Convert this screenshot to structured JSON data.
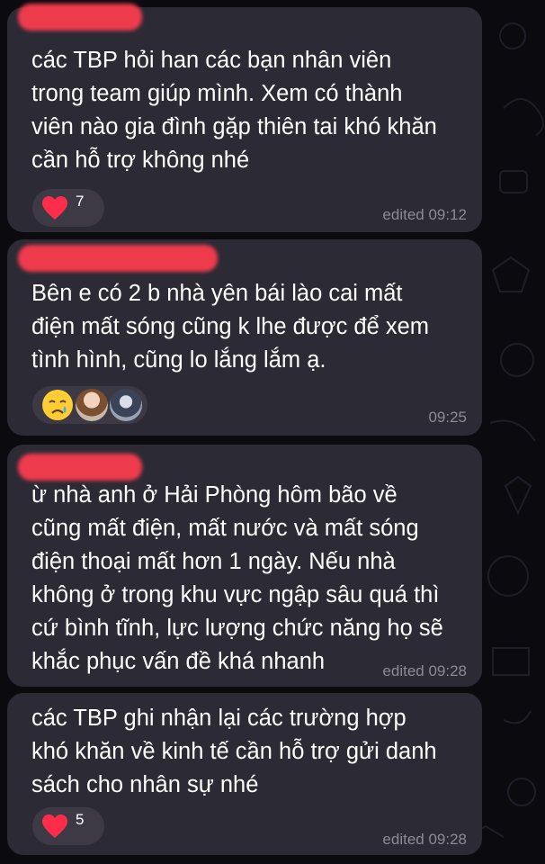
{
  "messages": [
    {
      "text": "các TBP hỏi han các bạn nhân viên\ntrong team giúp mình. Xem có thành\nviên nào gia đình gặp thiên tai khó khăn\ncần hỗ trợ không nhé",
      "reaction_icon": "heart-icon",
      "reaction_count": "7",
      "meta": "edited 09:12"
    },
    {
      "text": "Bên e có 2 b nhà yên bái lào cai mất\nđiện mất sóng cũng k lhe được để xem\ntình hình, cũng lo lắng lắm ạ.",
      "reaction_icon": "crying-face-icon",
      "meta": "09:25"
    },
    {
      "text": "ừ nhà anh ở Hải Phòng hôm bão về\ncũng mất điện, mất nước và mất sóng\nđiện thoại mất hơn 1 ngày. Nếu nhà\nkhông ở trong khu vực ngập sâu quá thì\ncứ bình tĩnh, lực lượng chức năng họ sẽ\nkhắc phục vấn đề khá nhanh",
      "meta": "edited 09:28"
    },
    {
      "text": "các TBP ghi nhận lại các trường hợp\nkhó khăn về kinh tế cần hỗ trợ gửi danh\nsách cho nhân sự nhé",
      "reaction_icon": "heart-icon",
      "reaction_count": "5",
      "meta": "edited 09:28"
    }
  ],
  "colors": {
    "background": "#0b0a0f",
    "bubble": "#2c2a35",
    "reaction_pill": "#3d3a46",
    "heart": "#ff2d4a",
    "redaction": "#ff3d4f",
    "meta_text": "#8d8a97"
  }
}
